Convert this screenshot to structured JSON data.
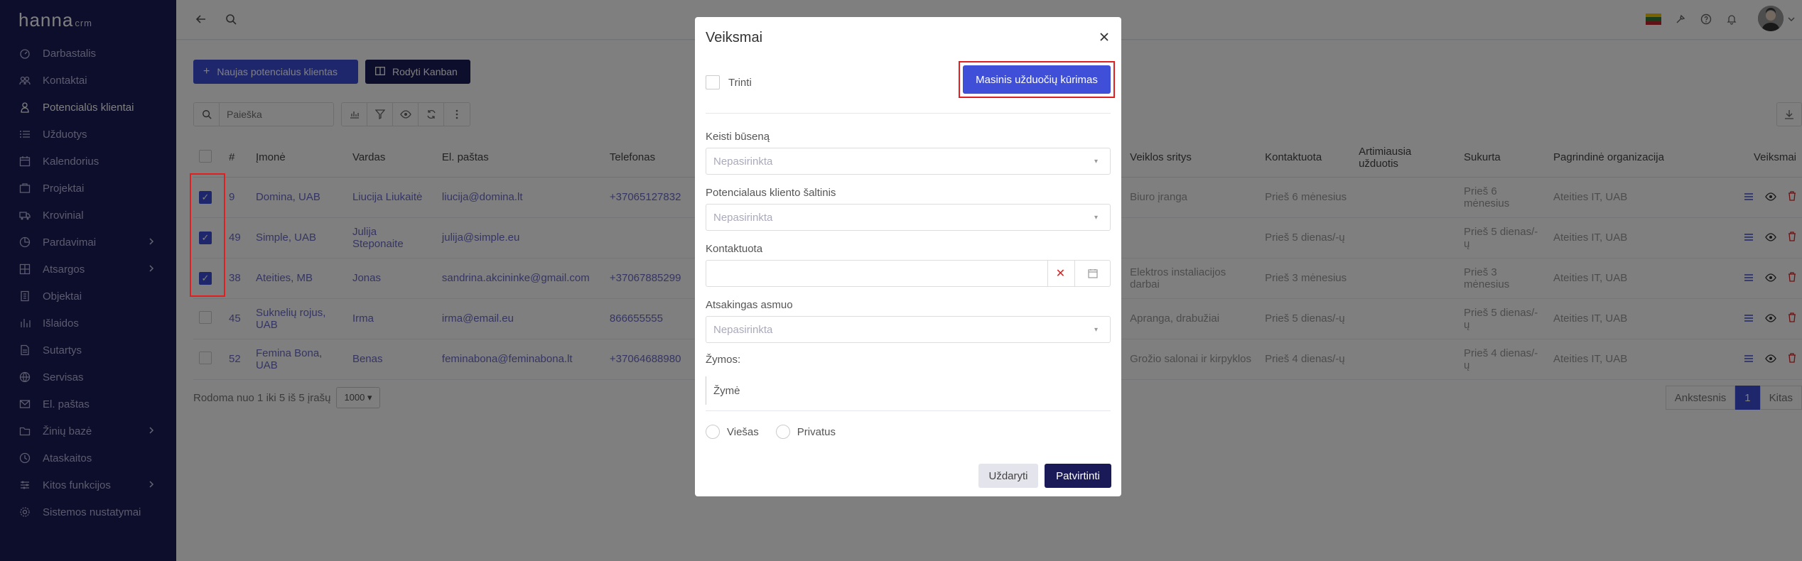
{
  "app": {
    "logo_main": "hanna",
    "logo_sub": "crm"
  },
  "sidebar": {
    "items": [
      {
        "label": "Darbastalis",
        "icon": "dashboard-icon"
      },
      {
        "label": "Kontaktai",
        "icon": "contacts-icon"
      },
      {
        "label": "Potencialūs klientai",
        "icon": "leads-icon",
        "active": true
      },
      {
        "label": "Užduotys",
        "icon": "tasks-icon"
      },
      {
        "label": "Kalendorius",
        "icon": "calendar-icon"
      },
      {
        "label": "Projektai",
        "icon": "projects-icon"
      },
      {
        "label": "Krovinial",
        "icon": "truck-icon"
      },
      {
        "label": "Pardavimai",
        "icon": "sales-icon",
        "has_children": true
      },
      {
        "label": "Atsargos",
        "icon": "inventory-icon",
        "has_children": true
      },
      {
        "label": "Objektai",
        "icon": "objects-icon"
      },
      {
        "label": "Išlaidos",
        "icon": "expenses-icon"
      },
      {
        "label": "Sutartys",
        "icon": "contracts-icon"
      },
      {
        "label": "Servisas",
        "icon": "service-icon"
      },
      {
        "label": "El. paštas",
        "icon": "mail-icon"
      },
      {
        "label": "Žinių bazė",
        "icon": "folder-icon",
        "has_children": true
      },
      {
        "label": "Ataskaitos",
        "icon": "reports-icon"
      },
      {
        "label": "Kitos funkcijos",
        "icon": "functions-icon",
        "has_children": true
      },
      {
        "label": "Sistemos nustatymai",
        "icon": "settings-icon"
      }
    ]
  },
  "toolbar": {
    "new_lead_label": "Naujas potencialus klientas",
    "kanban_label": "Rodyti Kanban",
    "search_placeholder": "Paieška"
  },
  "table": {
    "headers": [
      "#",
      "Įmonė",
      "Vardas",
      "El. paštas",
      "Telefonas",
      "",
      "Veiklos sritys",
      "Kontaktuota",
      "Artimiausia užduotis",
      "Sukurta",
      "Pagrindinė organizacija",
      "Veiksmai"
    ],
    "rows": [
      {
        "checked": true,
        "id": "9",
        "company": "Domina, UAB",
        "name": "Liucija Liukaitė",
        "email": "liucija@domina.lt",
        "phone": "+37065127832",
        "sector": "Biuro įranga",
        "contacted": "Prieš 6 mėnesius",
        "created": "Prieš 6 mėnesius",
        "org": "Ateities IT, UAB"
      },
      {
        "checked": true,
        "id": "49",
        "company": "Simple, UAB",
        "name": "Julija Steponaite",
        "email": "julija@simple.eu",
        "phone": "",
        "sector": "",
        "contacted": "Prieš 5 dienas/-ų",
        "created": "Prieš 5 dienas/-ų",
        "org": "Ateities IT, UAB"
      },
      {
        "checked": true,
        "id": "38",
        "company": "Ateities, MB",
        "name": "Jonas",
        "email": "sandrina.akcininke@gmail.com",
        "phone": "+37067885299",
        "sector": "Elektros instaliacijos darbai",
        "contacted": "Prieš 3 mėnesius",
        "created": "Prieš 3 mėnesius",
        "org": "Ateities IT, UAB"
      },
      {
        "checked": false,
        "id": "45",
        "company": "Suknelių rojus, UAB",
        "name": "Irma",
        "email": "irma@email.eu",
        "phone": "866655555",
        "sector": "Apranga, drabužiai",
        "contacted": "Prieš 5 dienas/-ų",
        "created": "Prieš 5 dienas/-ų",
        "org": "Ateities IT, UAB"
      },
      {
        "checked": false,
        "id": "52",
        "company": "Femina Bona, UAB",
        "name": "Benas",
        "email": "feminabona@feminabona.lt",
        "phone": "+37064688980",
        "sector": "Grožio salonai ir kirpyklos",
        "contacted": "Prieš 4 dienas/-ų",
        "created": "Prieš 4 dienas/-ų",
        "org": "Ateities IT, UAB"
      }
    ]
  },
  "footer": {
    "showing": "Rodoma nuo 1 iki 5 iš 5 įrašų",
    "page_size": "1000",
    "prev": "Ankstesnis",
    "current": "1",
    "next": "Kitas"
  },
  "modal": {
    "title": "Veiksmai",
    "delete_label": "Trinti",
    "mass_tasks_button": "Masinis užduočių kūrimas",
    "status_label": "Keisti būseną",
    "status_placeholder": "Nepasirinkta",
    "source_label": "Potencialaus kliento šaltinis",
    "source_placeholder": "Nepasirinkta",
    "contacted_label": "Kontaktuota",
    "responsible_label": "Atsakingas asmuo",
    "responsible_placeholder": "Nepasirinkta",
    "tags_label": "Žymos:",
    "tag_placeholder": "Žymė",
    "public_label": "Viešas",
    "private_label": "Privatus",
    "close_button": "Uždaryti",
    "confirm_button": "Patvirtinti"
  },
  "colors": {
    "sidebar_bg": "#1b1a59",
    "accent": "#3f4fd8",
    "highlight": "#e02020"
  }
}
